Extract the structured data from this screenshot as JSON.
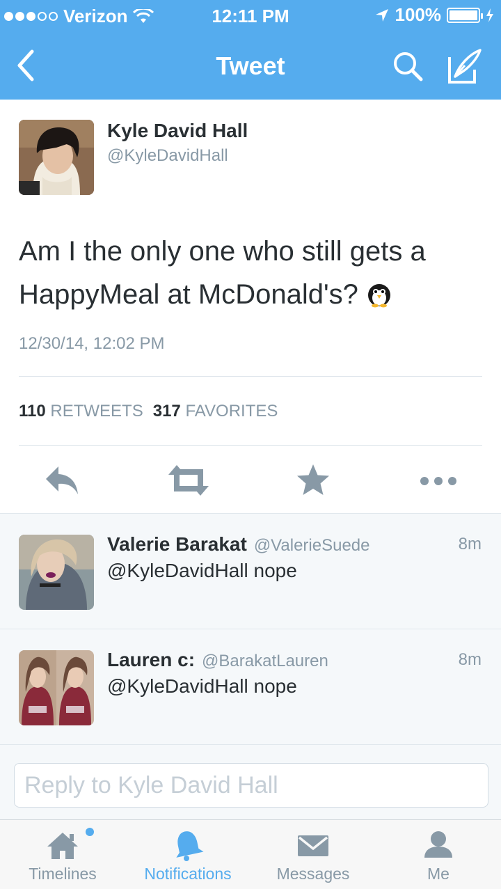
{
  "status_bar": {
    "carrier": "Verizon",
    "time": "12:11 PM",
    "battery": "100%"
  },
  "nav": {
    "title": "Tweet",
    "back_icon": "chevron-left-icon",
    "search_icon": "search-icon",
    "compose_icon": "compose-icon"
  },
  "tweet": {
    "author_name": "Kyle David Hall",
    "author_handle": "@KyleDavidHall",
    "text": "Am I the only one who still gets a HappyMeal at McDonald's?",
    "emoji": "penguin-emoji",
    "timestamp": "12/30/14, 12:02 PM",
    "retweet_count": "110",
    "retweet_label": "RETWEETS",
    "favorite_count": "317",
    "favorite_label": "FAVORITES"
  },
  "actions": [
    "reply-icon",
    "retweet-icon",
    "favorite-icon",
    "more-icon"
  ],
  "replies": [
    {
      "name": "Valerie Barakat",
      "handle": "@ValerieSuede",
      "age": "8m",
      "text": "@KyleDavidHall nope"
    },
    {
      "name": "Lauren c:",
      "handle": "@BarakatLauren",
      "age": "8m",
      "text": "@KyleDavidHall nope"
    }
  ],
  "reply_box": {
    "placeholder": "Reply to Kyle David Hall"
  },
  "tabs": [
    {
      "label": "Timelines",
      "icon": "home-icon",
      "active": false,
      "badge": true
    },
    {
      "label": "Notifications",
      "icon": "bell-icon",
      "active": true
    },
    {
      "label": "Messages",
      "icon": "envelope-icon",
      "active": false
    },
    {
      "label": "Me",
      "icon": "person-icon",
      "active": false
    }
  ],
  "colors": {
    "accent": "#55acee",
    "text": "#292f33",
    "muted": "#8899a6",
    "action_icon": "#8899a6"
  }
}
